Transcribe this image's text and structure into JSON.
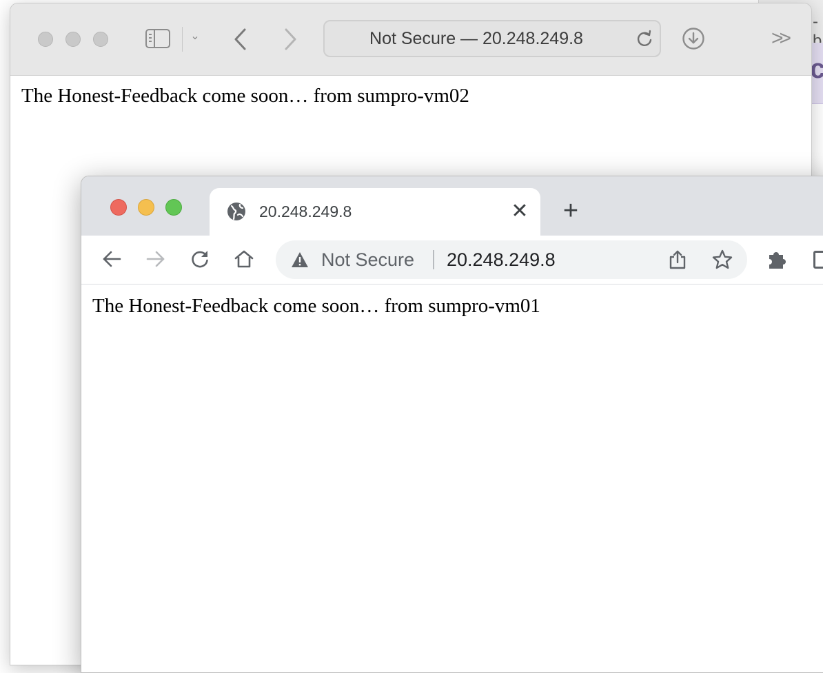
{
  "background_window": {
    "title_fragment": "-b",
    "content_fragment": "c"
  },
  "safari": {
    "address_text": "Not Secure — 20.248.249.8",
    "more_label": ">>",
    "sidebar_chevron": "⌄",
    "page_text": "The Honest-Feedback come soon… from sumpro-vm02"
  },
  "chrome": {
    "tab": {
      "title": "20.248.249.8",
      "close_label": "✕"
    },
    "new_tab_label": "+",
    "omnibox": {
      "security_label": "Not Secure",
      "url": "20.248.249.8"
    },
    "page_text": "The Honest-Feedback come soon… from sumpro-vm01"
  },
  "colors": {
    "close_red": "#ee6a5f",
    "minimize_yellow": "#f5bf4f",
    "zoom_green": "#62c655",
    "inactive_grey": "#c9c9c9"
  }
}
